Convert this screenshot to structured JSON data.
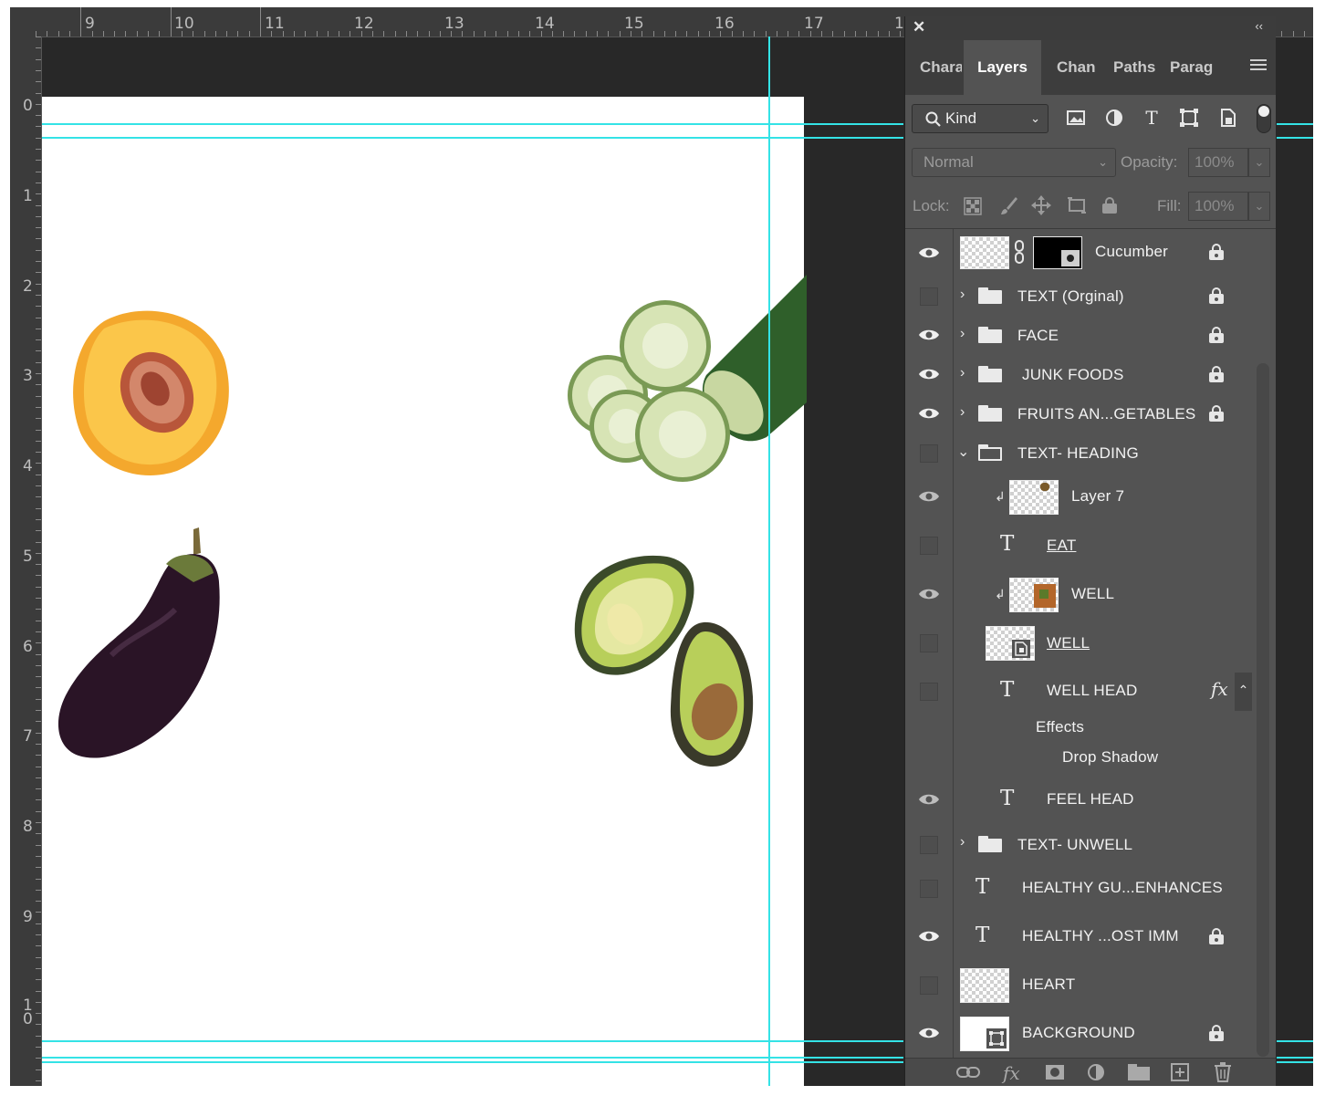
{
  "rulers": {
    "top": [
      "9",
      "10",
      "11",
      "12",
      "13",
      "14",
      "15",
      "16",
      "17",
      "1"
    ],
    "left": [
      "0",
      "1",
      "2",
      "3",
      "4",
      "5",
      "6",
      "7",
      "8",
      "9",
      "1\n0"
    ]
  },
  "panel": {
    "tabs": [
      "Chara",
      "Layers",
      "Chan",
      "Paths",
      "Parag"
    ],
    "active_tab": "Layers",
    "filter": {
      "kind_label": "Kind"
    },
    "blend_mode": "Normal",
    "opacity_label": "Opacity:",
    "opacity_value": "100%",
    "lock_label": "Lock:",
    "fill_label": "Fill:",
    "fill_value": "100%",
    "layers": [
      {
        "name": "Cucumber",
        "visible": true,
        "locked": true
      },
      {
        "name": "TEXT (Orginal)",
        "visible": false,
        "locked": true
      },
      {
        "name": "FACE",
        "visible": true,
        "locked": true
      },
      {
        "name": "JUNK FOODS",
        "visible": true,
        "locked": true
      },
      {
        "name": "FRUITS AN...GETABLES",
        "visible": true,
        "locked": true
      },
      {
        "name": "TEXT- HEADING",
        "visible": false,
        "locked": false
      },
      {
        "name": "Layer 7",
        "visible": true,
        "locked": false
      },
      {
        "name": "EAT",
        "visible": false,
        "locked": false
      },
      {
        "name": "WELL",
        "visible": true,
        "locked": false
      },
      {
        "name": "WELL",
        "visible": false,
        "locked": false
      },
      {
        "name": "WELL HEAD",
        "visible": false,
        "locked": false,
        "effects_label": "Effects",
        "effect": "Drop Shadow"
      },
      {
        "name": "FEEL HEAD",
        "visible": true,
        "locked": false
      },
      {
        "name": "TEXT- UNWELL",
        "visible": false,
        "locked": false
      },
      {
        "name": "HEALTHY GU...ENHANCES",
        "visible": false,
        "locked": false
      },
      {
        "name": "HEALTHY ...OST IMM",
        "visible": true,
        "locked": true
      },
      {
        "name": "HEART",
        "visible": false,
        "locked": false
      },
      {
        "name": "BACKGROUND",
        "visible": true,
        "locked": true
      }
    ]
  },
  "canvas": {
    "images": [
      "peach-half",
      "cucumber-slices",
      "eggplant",
      "avocado"
    ]
  },
  "colors": {
    "guide": "#34e3e6",
    "panel": "#535353",
    "workspace": "#282828"
  }
}
